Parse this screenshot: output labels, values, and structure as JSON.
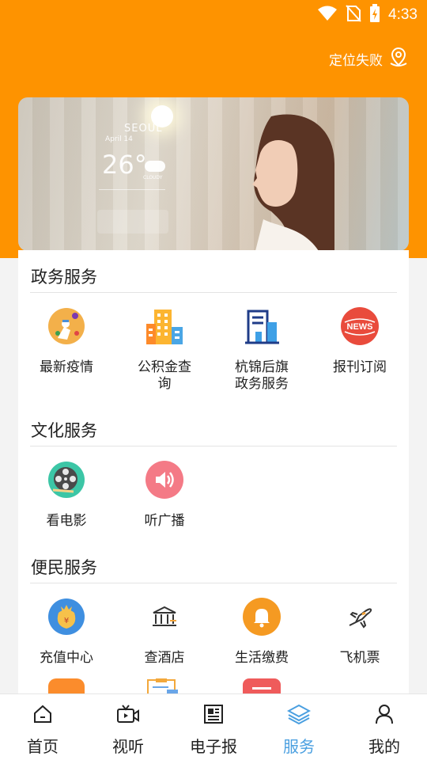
{
  "status_bar": {
    "time": "4:33"
  },
  "location": {
    "label": "定位失败"
  },
  "banner": {
    "city": "SEOUL",
    "date": "April 14",
    "temp": "26°",
    "weather": "CLOUDY"
  },
  "sections": [
    {
      "title": "政务服务",
      "items": [
        {
          "label": "最新疫情",
          "icon": "epidemic-icon"
        },
        {
          "label": "公积金查询",
          "icon": "building-icon"
        },
        {
          "label": "杭锦后旗政务服务",
          "icon": "government-icon"
        },
        {
          "label": "报刊订阅",
          "icon": "news-icon"
        }
      ]
    },
    {
      "title": "文化服务",
      "items": [
        {
          "label": "看电影",
          "icon": "film-reel-icon"
        },
        {
          "label": "听广播",
          "icon": "speaker-icon"
        }
      ]
    },
    {
      "title": "便民服务",
      "items": [
        {
          "label": "充值中心",
          "icon": "money-bag-icon"
        },
        {
          "label": "查酒店",
          "icon": "hotel-icon"
        },
        {
          "label": "生活缴费",
          "icon": "bell-icon"
        },
        {
          "label": "飞机票",
          "icon": "airplane-icon"
        }
      ]
    }
  ],
  "tabs": [
    {
      "label": "首页",
      "icon": "home-icon",
      "active": false
    },
    {
      "label": "视听",
      "icon": "video-icon",
      "active": false
    },
    {
      "label": "电子报",
      "icon": "newspaper-icon",
      "active": false
    },
    {
      "label": "服务",
      "icon": "layers-icon",
      "active": true
    },
    {
      "label": "我的",
      "icon": "user-icon",
      "active": false
    }
  ],
  "colors": {
    "header": "#fe9300",
    "active_tab": "#4a9fe0"
  }
}
